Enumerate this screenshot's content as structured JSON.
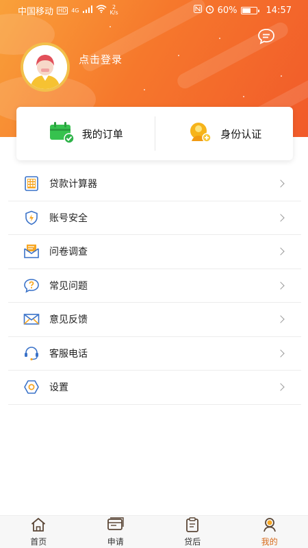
{
  "status_bar": {
    "carrier": "中国移动",
    "hd": "HD",
    "signal_type": "4G",
    "net_speed_value": "2",
    "net_speed_unit": "K/s",
    "battery": "60%",
    "time": "14:57"
  },
  "profile": {
    "login_text": "点击登录"
  },
  "quick_card": {
    "orders_label": "我的订单",
    "identity_label": "身份认证"
  },
  "menu": {
    "items": [
      {
        "label": "贷款计算器"
      },
      {
        "label": "账号安全"
      },
      {
        "label": "问卷调查"
      },
      {
        "label": "常见问题"
      },
      {
        "label": "意见反馈"
      },
      {
        "label": "客服电话"
      },
      {
        "label": "设置"
      }
    ]
  },
  "tabbar": {
    "tabs": [
      {
        "label": "首页"
      },
      {
        "label": "申请"
      },
      {
        "label": "贷后"
      },
      {
        "label": "我的"
      }
    ],
    "active_index": 3
  },
  "colors": {
    "accent": "#f6782c",
    "icon_blue": "#3a72c8",
    "active_tab": "#d86a1a"
  }
}
